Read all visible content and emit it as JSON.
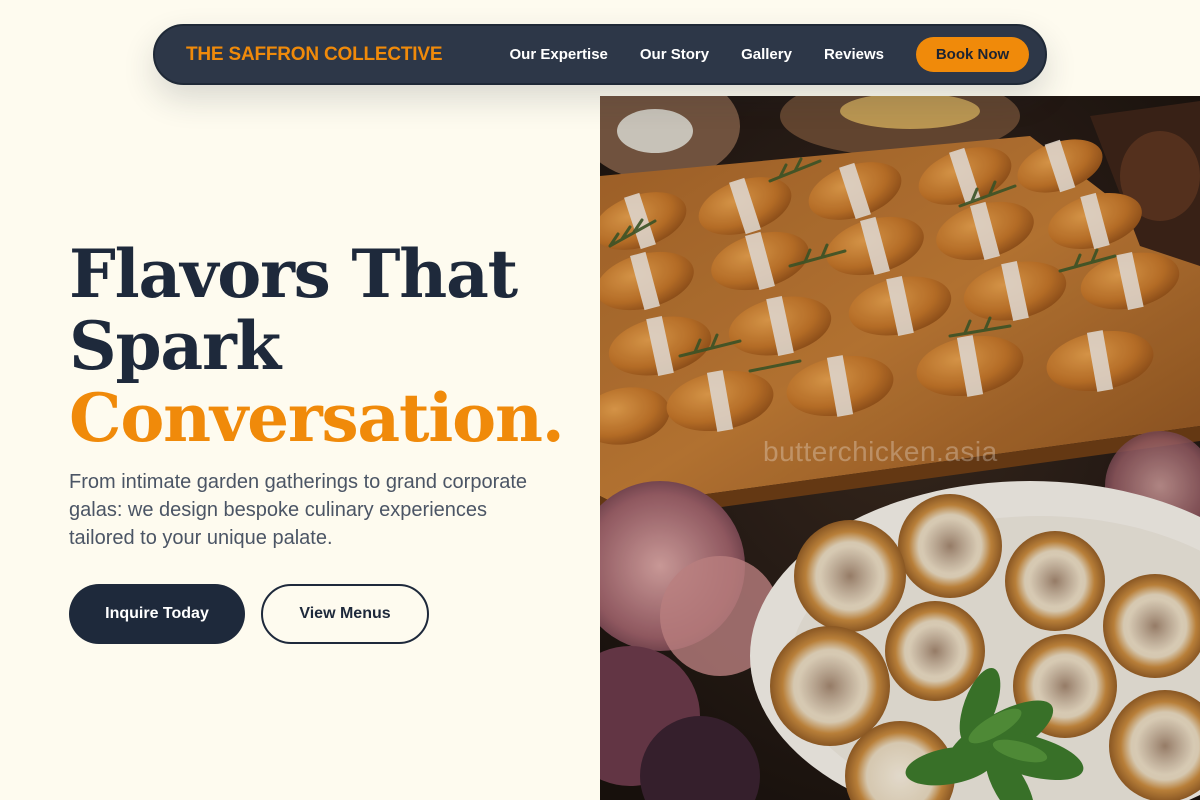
{
  "nav": {
    "brand": "THE SAFFRON COLLECTIVE",
    "links": [
      "Our Expertise",
      "Our Story",
      "Gallery",
      "Reviews"
    ],
    "cta": "Book Now"
  },
  "hero": {
    "headline_line1": "Flavors That",
    "headline_line2": "Spark",
    "headline_accent": "Conversation.",
    "subtext": "From intimate garden gatherings to grand corporate galas: we design bespoke culinary experiences tailored to your unique palate.",
    "primary_cta": "Inquire Today",
    "secondary_cta": "View Menus"
  },
  "photo": {
    "watermark": "butterchicken.asia"
  },
  "colors": {
    "accent": "#f08a0a",
    "navy": "#1e293b",
    "background": "#fefbef"
  }
}
